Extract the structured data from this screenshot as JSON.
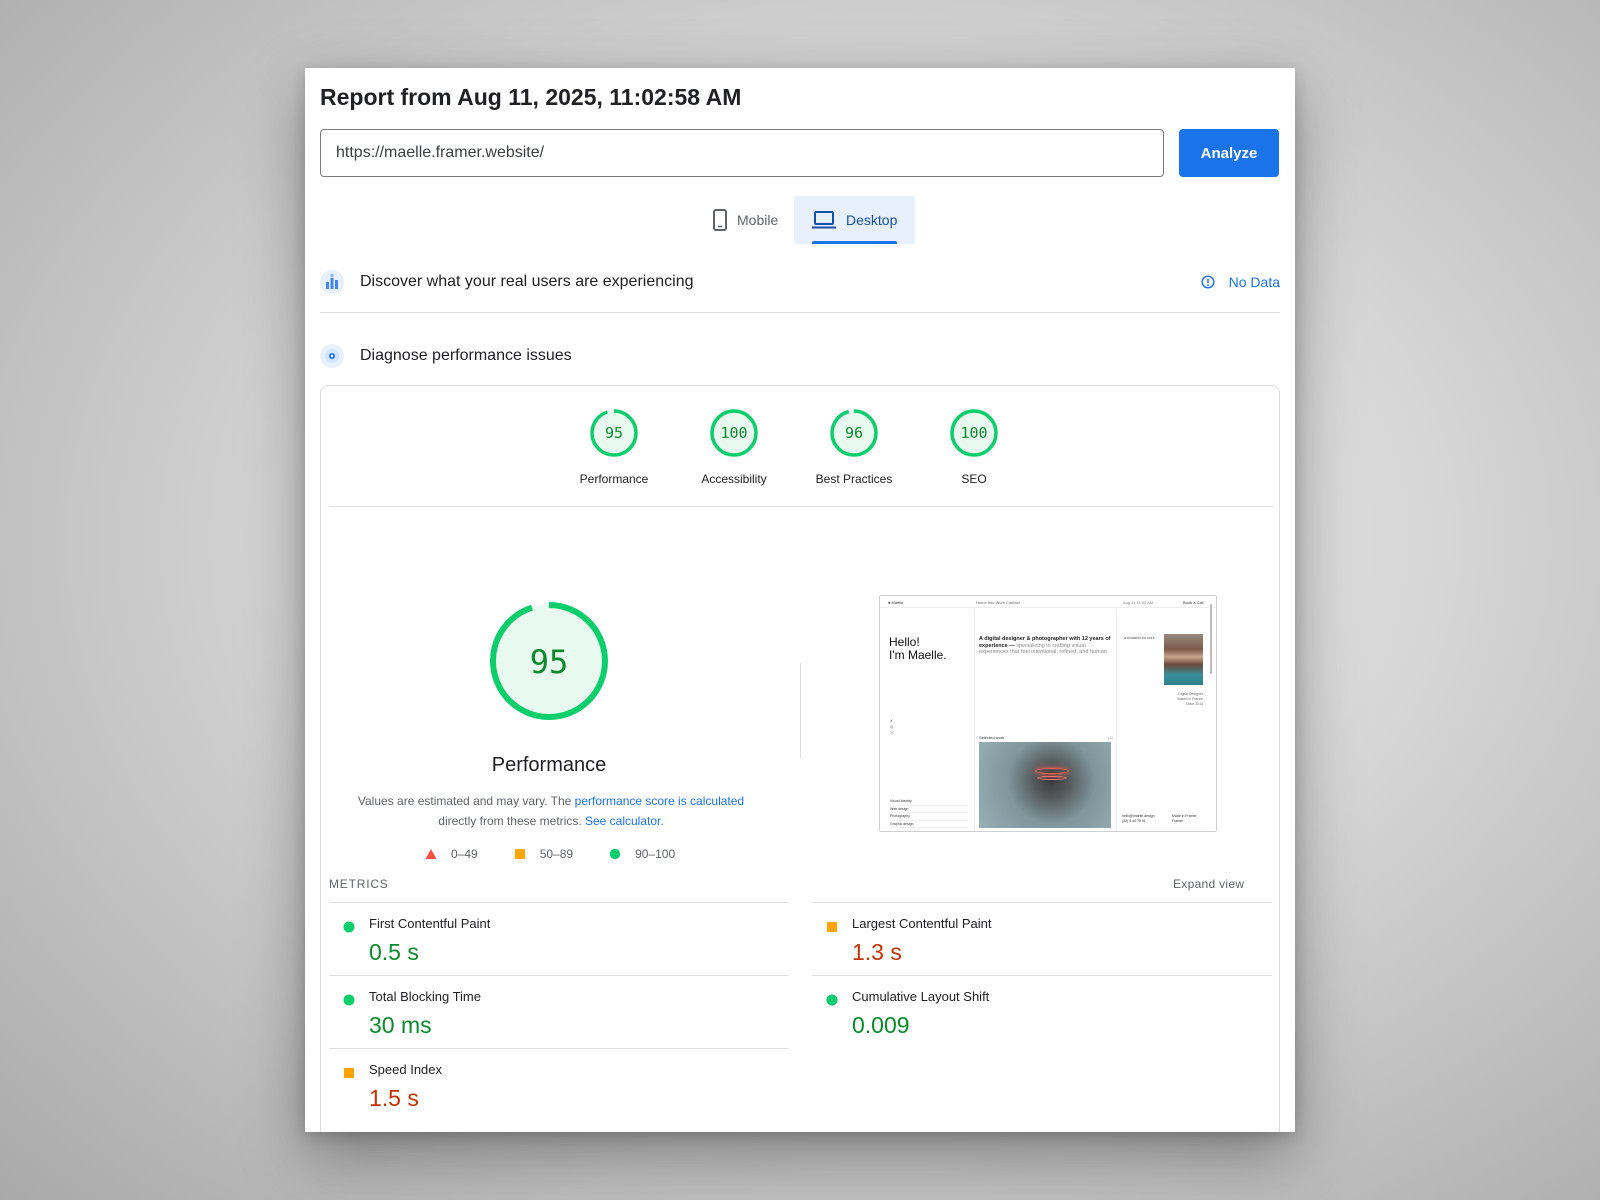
{
  "report": {
    "title": "Report from Aug 11, 2025, 11:02:58 AM"
  },
  "url_bar": {
    "value": "https://maelle.framer.website/",
    "analyze_label": "Analyze"
  },
  "tabs": [
    {
      "label": "Mobile",
      "icon": "phone-icon",
      "active": false
    },
    {
      "label": "Desktop",
      "icon": "laptop-icon",
      "active": true
    }
  ],
  "discover": {
    "title": "Discover what your real users are experiencing",
    "status": "No Data"
  },
  "diagnose": {
    "title": "Diagnose performance issues"
  },
  "colors": {
    "good": "#0cce6b",
    "good_text": "#0a8a2a",
    "average": "#ffa400",
    "average_text": "#c33300",
    "poor": "#ff4e42",
    "accent": "#1a73e8"
  },
  "scores": [
    {
      "label": "Performance",
      "value": 95
    },
    {
      "label": "Accessibility",
      "value": 100
    },
    {
      "label": "Best Practices",
      "value": 96
    },
    {
      "label": "SEO",
      "value": 100
    }
  ],
  "main_score": {
    "value": 95,
    "label": "Performance",
    "explain_prefix": "Values are estimated and may vary. The ",
    "explain_link": "performance score is calculated",
    "explain_middle": " directly from these metrics. ",
    "calc_link": "See calculator."
  },
  "legend": [
    {
      "range": "0–49",
      "shape": "triangle"
    },
    {
      "range": "50–89",
      "shape": "square"
    },
    {
      "range": "90–100",
      "shape": "circle"
    }
  ],
  "screenshot": {
    "logo": "● Maelle",
    "links": "Home  Info  Work  Contact",
    "date": "Aug 11 11:02 AM",
    "book": "Book a Call",
    "hello_line1": "Hello!",
    "hello_line2": "I'm Maelle.",
    "desc_bold": "A digital designer & photographer with 12 years of experience —",
    "desc_muted": " specializing in crafting visual experiences that feel intentional, refined, and human.",
    "available": "● Available for work",
    "role_1": "Digital Designer",
    "role_2": "Based in France",
    "role_3": "Since 2013",
    "icons": "X\n◎\nⓔ",
    "selected_label": "Selected work",
    "selected_right": "(4)",
    "services": [
      "Visual Identity",
      "Web design",
      "Photography",
      "Graphic design"
    ],
    "contact_1": "hello@maelle.design",
    "contact_2": "(33) 6 44 78 91",
    "credit_1": "Made in Framer",
    "credit_2": "Framer"
  },
  "metrics": {
    "header": "METRICS",
    "expand": "Expand view",
    "items": [
      {
        "name": "First Contentful Paint",
        "value": "0.5 s",
        "rating": "good"
      },
      {
        "name": "Largest Contentful Paint",
        "value": "1.3 s",
        "rating": "average"
      },
      {
        "name": "Total Blocking Time",
        "value": "30 ms",
        "rating": "good"
      },
      {
        "name": "Cumulative Layout Shift",
        "value": "0.009",
        "rating": "good"
      },
      {
        "name": "Speed Index",
        "value": "1.5 s",
        "rating": "average"
      }
    ]
  }
}
